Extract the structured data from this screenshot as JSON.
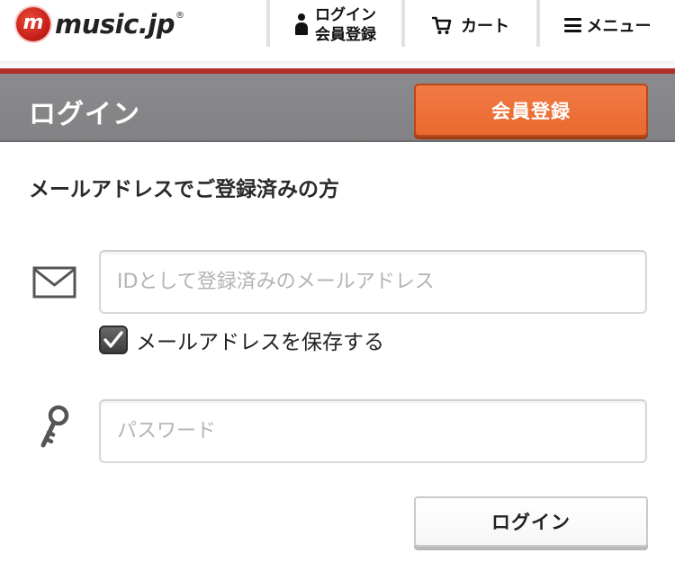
{
  "header": {
    "logo_badge": "m",
    "logo_text": "music.jp",
    "logo_reg": "®",
    "login_line1": "ログイン",
    "login_line2": "会員登録",
    "cart_label": "カート",
    "menu_label": "メニュー",
    "icons": {
      "login": "person-icon",
      "cart": "cart-icon",
      "menu": "hamburger-menu-icon"
    }
  },
  "title_bar": {
    "title": "ログイン",
    "register_button": "会員登録"
  },
  "form": {
    "heading": "メールアドレスでご登録済みの方",
    "email": {
      "placeholder": "IDとして登録済みのメールアドレス",
      "value": "",
      "icon": "mail-icon"
    },
    "remember": {
      "label": "メールアドレスを保存する",
      "checked": true
    },
    "password": {
      "placeholder": "パスワード",
      "value": "",
      "icon": "key-icon"
    },
    "submit_label": "ログイン"
  },
  "colors": {
    "brand_red": "#b0302c",
    "accent_orange": "#ef7440",
    "title_bar_gray": "#878789"
  }
}
